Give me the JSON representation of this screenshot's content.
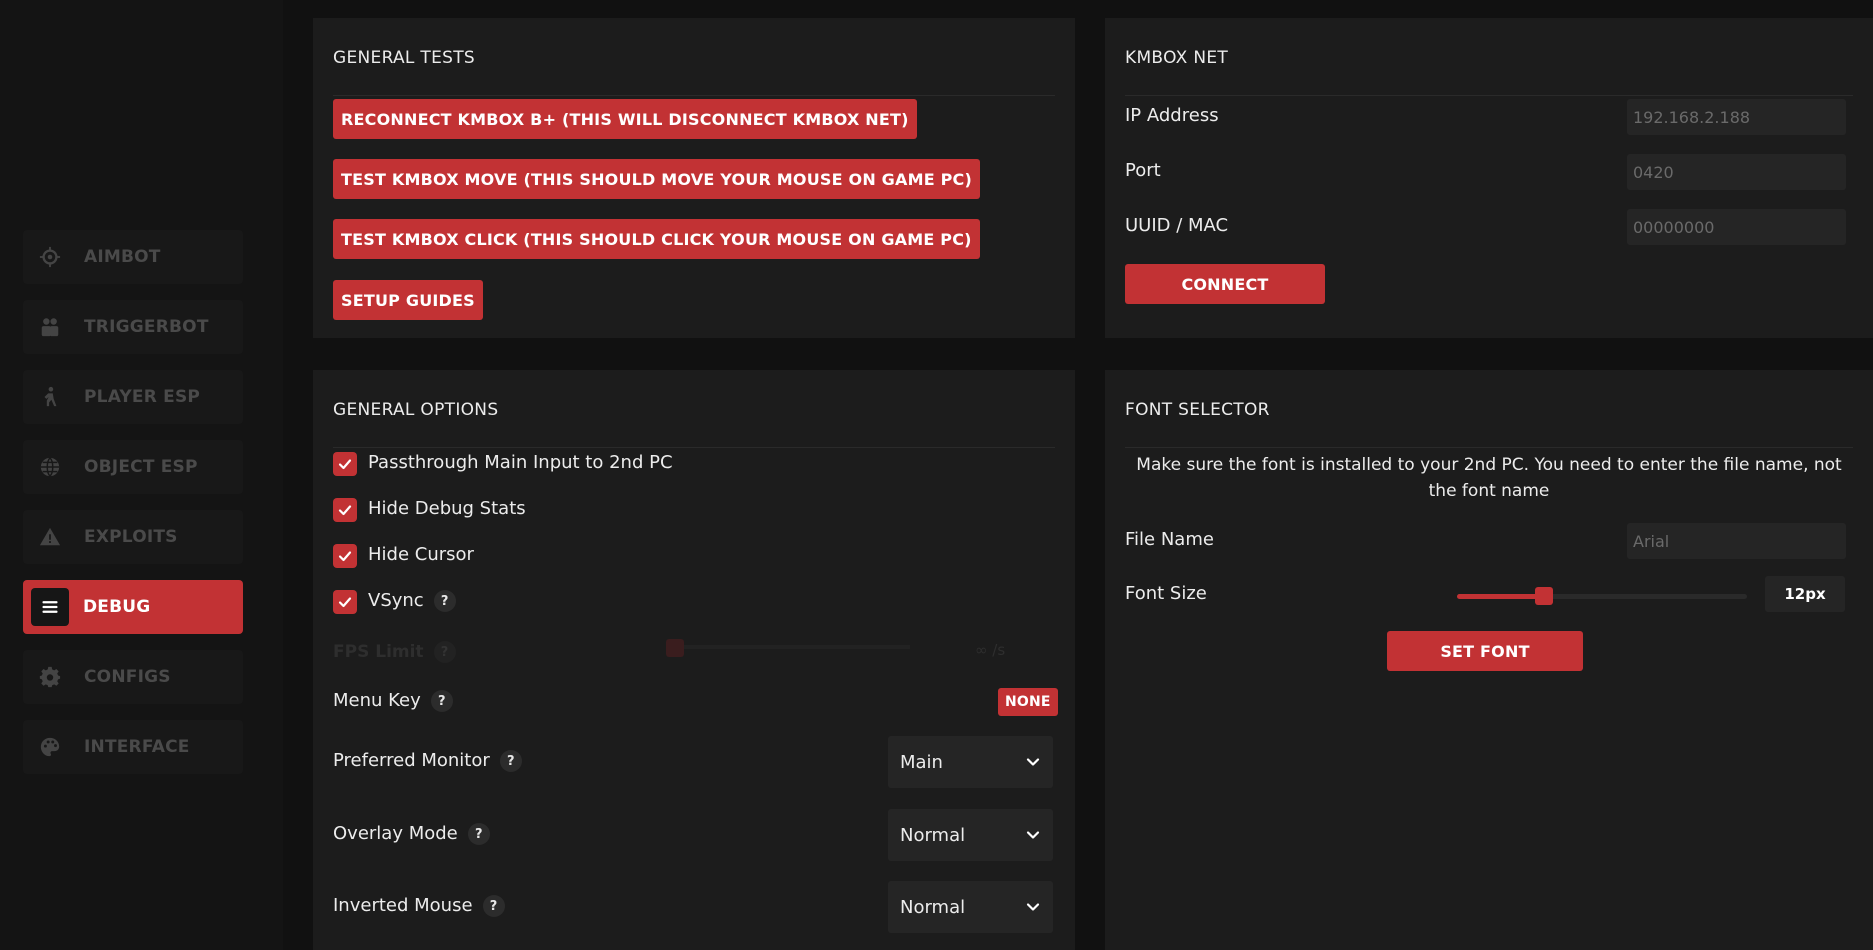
{
  "sidebar": {
    "items": [
      {
        "label": "AIMBOT",
        "icon": "crosshair-icon"
      },
      {
        "label": "TRIGGERBOT",
        "icon": "users-icon"
      },
      {
        "label": "PLAYER ESP",
        "icon": "walking-person-icon"
      },
      {
        "label": "OBJECT ESP",
        "icon": "globe-icon"
      },
      {
        "label": "EXPLOITS",
        "icon": "warning-icon"
      },
      {
        "label": "DEBUG",
        "icon": "menu-icon",
        "active": true
      },
      {
        "label": "CONFIGS",
        "icon": "gear-icon"
      },
      {
        "label": "INTERFACE",
        "icon": "palette-icon"
      }
    ]
  },
  "general_tests": {
    "title": "GENERAL TESTS",
    "buttons": [
      "RECONNECT KMBOX B+ (THIS WILL DISCONNECT KMBOX NET)",
      "TEST KMBOX MOVE (THIS SHOULD MOVE YOUR MOUSE ON GAME PC)",
      "TEST KMBOX CLICK (THIS SHOULD CLICK YOUR MOUSE ON GAME PC)",
      "SETUP GUIDES"
    ]
  },
  "kmbox_net": {
    "title": "KMBOX NET",
    "ip_label": "IP Address",
    "ip_placeholder": "192.168.2.188",
    "port_label": "Port",
    "port_placeholder": "0420",
    "uuid_label": "UUID / MAC",
    "uuid_placeholder": "00000000",
    "connect_label": "CONNECT"
  },
  "general_options": {
    "title": "GENERAL OPTIONS",
    "checkboxes": [
      {
        "label": "Passthrough Main Input to 2nd PC",
        "checked": true
      },
      {
        "label": "Hide Debug Stats",
        "checked": true
      },
      {
        "label": "Hide Cursor",
        "checked": true
      },
      {
        "label": "VSync",
        "checked": true
      }
    ],
    "help_glyph": "?",
    "fps_limit_label": "FPS Limit",
    "fps_limit_value": "∞ /s",
    "menu_key_label": "Menu Key",
    "menu_key_value": "NONE",
    "preferred_monitor_label": "Preferred Monitor",
    "preferred_monitor_value": "Main",
    "overlay_mode_label": "Overlay Mode",
    "overlay_mode_value": "Normal",
    "inverted_mouse_label": "Inverted Mouse",
    "inverted_mouse_value": "Normal"
  },
  "font_selector": {
    "title": "FONT SELECTOR",
    "note": "Make sure the font is installed to your 2nd PC. You need to enter the file name, not the font name",
    "file_name_label": "File Name",
    "file_name_placeholder": "Arial",
    "font_size_label": "Font Size",
    "font_size_value": "12px",
    "font_size_fraction": 0.3,
    "set_font_label": "SET FONT"
  },
  "colors": {
    "accent": "#c23234",
    "background": "#111111",
    "panel": "#1c1c1c"
  }
}
